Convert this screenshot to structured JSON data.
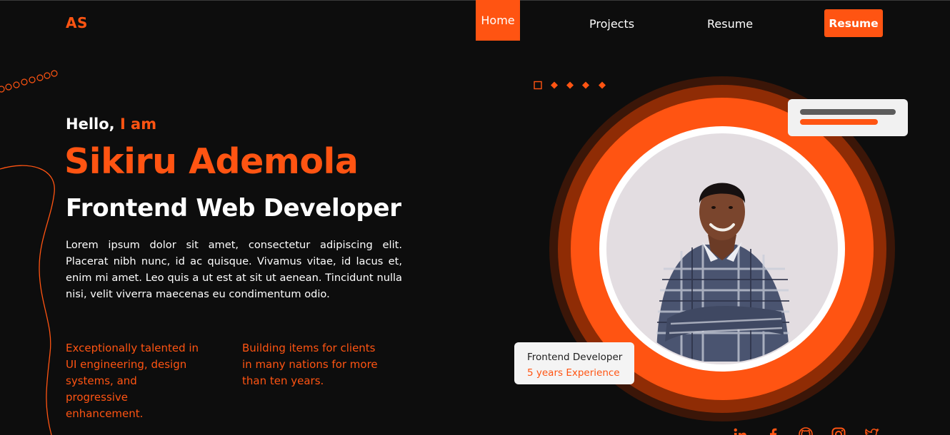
{
  "header": {
    "logo": "AS",
    "nav": {
      "home": "Home",
      "projects": "Projects",
      "resume": "Resume",
      "resume_button": "Resume"
    }
  },
  "hero": {
    "greeting_prefix": "Hello,",
    "greeting_accent": "I am",
    "name": "Sikiru Ademola",
    "role": "Frontend Web Developer",
    "intro": "Lorem ipsum dolor sit amet, consectetur adipiscing elit. Placerat nibh nunc, id ac quisque. Vivamus vitae, id lacus et, enim mi amet. Leo quis a ut est at sit ut aenean. Tincidunt nulla nisi, velit viverra maecenas eu condimentum odio.",
    "features": [
      "Exceptionally talented in UI engineering, design systems, and progressive enhancement.",
      "Building items for clients in many nations for more than ten years."
    ]
  },
  "experience_card": {
    "title": "Frontend Developer",
    "subtitle": "5 years Experience"
  },
  "socials": [
    "linkedin-icon",
    "facebook-icon",
    "github-icon",
    "instagram-icon",
    "twitter-icon"
  ],
  "colors": {
    "accent": "#ff5412",
    "background": "#0d0d0d",
    "ring_outer": "#3b1608",
    "ring_mid": "#8f2c05",
    "photo_bg": "#e3dde1"
  }
}
